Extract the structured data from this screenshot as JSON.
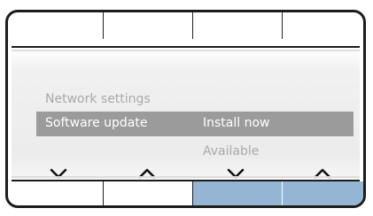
{
  "menu": {
    "items": [
      {
        "label": "Network settings",
        "value": "",
        "state": "dim"
      },
      {
        "label": "Software update",
        "value": "Install now",
        "state": "selected"
      },
      {
        "label": "",
        "value": "Available",
        "state": "dim"
      }
    ]
  },
  "nav_buttons": [
    {
      "icon": "chevron-down-icon",
      "direction": "down"
    },
    {
      "icon": "chevron-up-icon",
      "direction": "up"
    },
    {
      "icon": "chevron-down-icon",
      "direction": "down"
    },
    {
      "icon": "chevron-up-icon",
      "direction": "up"
    }
  ],
  "colors": {
    "selection": "#9b9b9b",
    "dim_text": "#a9a9a9",
    "lit_soft_key": "#94b6d4",
    "frame": "#1c1c1c"
  }
}
